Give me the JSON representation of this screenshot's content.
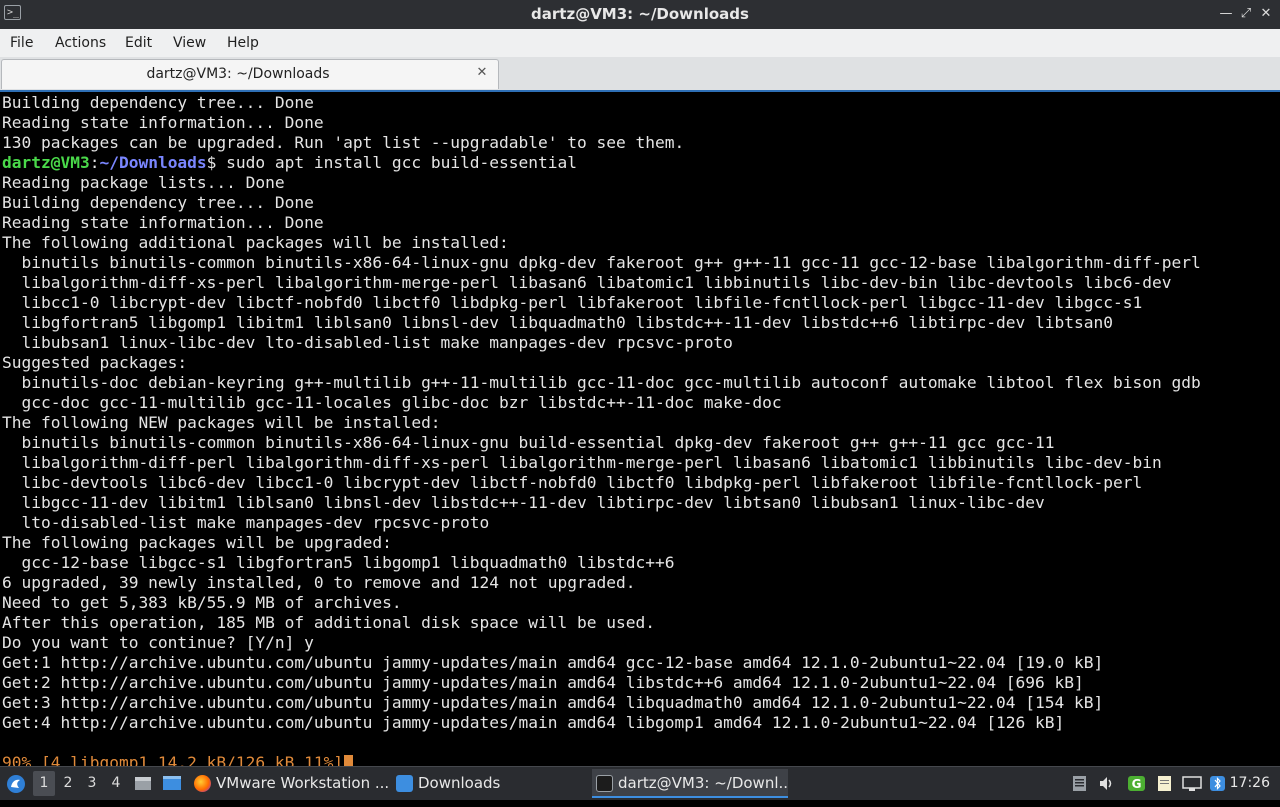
{
  "window": {
    "title": "dartz@VM3: ~/Downloads",
    "icons": {
      "app": "terminal-icon",
      "minimize": "minimize-icon",
      "maximize": "maximize-icon",
      "close": "close-icon"
    }
  },
  "menu": {
    "file": "File",
    "actions": "Actions",
    "edit": "Edit",
    "view": "View",
    "help": "Help"
  },
  "tab": {
    "label": "dartz@VM3: ~/Downloads",
    "close_icon": "close-icon"
  },
  "terminal": {
    "prompt": {
      "user": "dartz@VM3",
      "sep": ":",
      "dir": "~/Downloads",
      "sym": "$",
      "command": " sudo apt install gcc build-essential"
    },
    "lines_before": [
      "Building dependency tree... Done",
      "Reading state information... Done",
      "130 packages can be upgraded. Run 'apt list --upgradable' to see them."
    ],
    "lines_after": [
      "Reading package lists... Done",
      "Building dependency tree... Done",
      "Reading state information... Done",
      "The following additional packages will be installed:",
      "  binutils binutils-common binutils-x86-64-linux-gnu dpkg-dev fakeroot g++ g++-11 gcc-11 gcc-12-base libalgorithm-diff-perl",
      "  libalgorithm-diff-xs-perl libalgorithm-merge-perl libasan6 libatomic1 libbinutils libc-dev-bin libc-devtools libc6-dev",
      "  libcc1-0 libcrypt-dev libctf-nobfd0 libctf0 libdpkg-perl libfakeroot libfile-fcntllock-perl libgcc-11-dev libgcc-s1",
      "  libgfortran5 libgomp1 libitm1 liblsan0 libnsl-dev libquadmath0 libstdc++-11-dev libstdc++6 libtirpc-dev libtsan0",
      "  libubsan1 linux-libc-dev lto-disabled-list make manpages-dev rpcsvc-proto",
      "Suggested packages:",
      "  binutils-doc debian-keyring g++-multilib g++-11-multilib gcc-11-doc gcc-multilib autoconf automake libtool flex bison gdb",
      "  gcc-doc gcc-11-multilib gcc-11-locales glibc-doc bzr libstdc++-11-doc make-doc",
      "The following NEW packages will be installed:",
      "  binutils binutils-common binutils-x86-64-linux-gnu build-essential dpkg-dev fakeroot g++ g++-11 gcc gcc-11",
      "  libalgorithm-diff-perl libalgorithm-diff-xs-perl libalgorithm-merge-perl libasan6 libatomic1 libbinutils libc-dev-bin",
      "  libc-devtools libc6-dev libcc1-0 libcrypt-dev libctf-nobfd0 libctf0 libdpkg-perl libfakeroot libfile-fcntllock-perl",
      "  libgcc-11-dev libitm1 liblsan0 libnsl-dev libstdc++-11-dev libtirpc-dev libtsan0 libubsan1 linux-libc-dev",
      "  lto-disabled-list make manpages-dev rpcsvc-proto",
      "The following packages will be upgraded:",
      "  gcc-12-base libgcc-s1 libgfortran5 libgomp1 libquadmath0 libstdc++6",
      "6 upgraded, 39 newly installed, 0 to remove and 124 not upgraded.",
      "Need to get 5,383 kB/55.9 MB of archives.",
      "After this operation, 185 MB of additional disk space will be used.",
      "Do you want to continue? [Y/n] y",
      "Get:1 http://archive.ubuntu.com/ubuntu jammy-updates/main amd64 gcc-12-base amd64 12.1.0-2ubuntu1~22.04 [19.0 kB]",
      "Get:2 http://archive.ubuntu.com/ubuntu jammy-updates/main amd64 libstdc++6 amd64 12.1.0-2ubuntu1~22.04 [696 kB]",
      "Get:3 http://archive.ubuntu.com/ubuntu jammy-updates/main amd64 libquadmath0 amd64 12.1.0-2ubuntu1~22.04 [154 kB]",
      "Get:4 http://archive.ubuntu.com/ubuntu jammy-updates/main amd64 libgomp1 amd64 12.1.0-2ubuntu1~22.04 [126 kB]"
    ],
    "progress": "90% [4 libgomp1 14.2 kB/126 kB 11%]"
  },
  "taskbar": {
    "workspaces": [
      "1",
      "2",
      "3",
      "4"
    ],
    "tasks": [
      {
        "label": "VMware Workstation ...",
        "icon": "firefox-icon"
      },
      {
        "label": "Downloads",
        "icon": "folder-icon"
      },
      {
        "label": "dartz@VM3: ~/Downl...",
        "icon": "terminal-icon"
      }
    ],
    "tray_icons": [
      "clipboard-icon",
      "volume-icon",
      "update-icon",
      "notes-icon",
      "network-icon",
      "bluetooth-icon"
    ],
    "clock": "17:26"
  },
  "colors": {
    "prompt_user": "#4ad94a",
    "prompt_dir": "#7a86ff",
    "progress": "#e08a3a",
    "accent": "#3d8ee0",
    "terminal_bg": "#000000"
  }
}
